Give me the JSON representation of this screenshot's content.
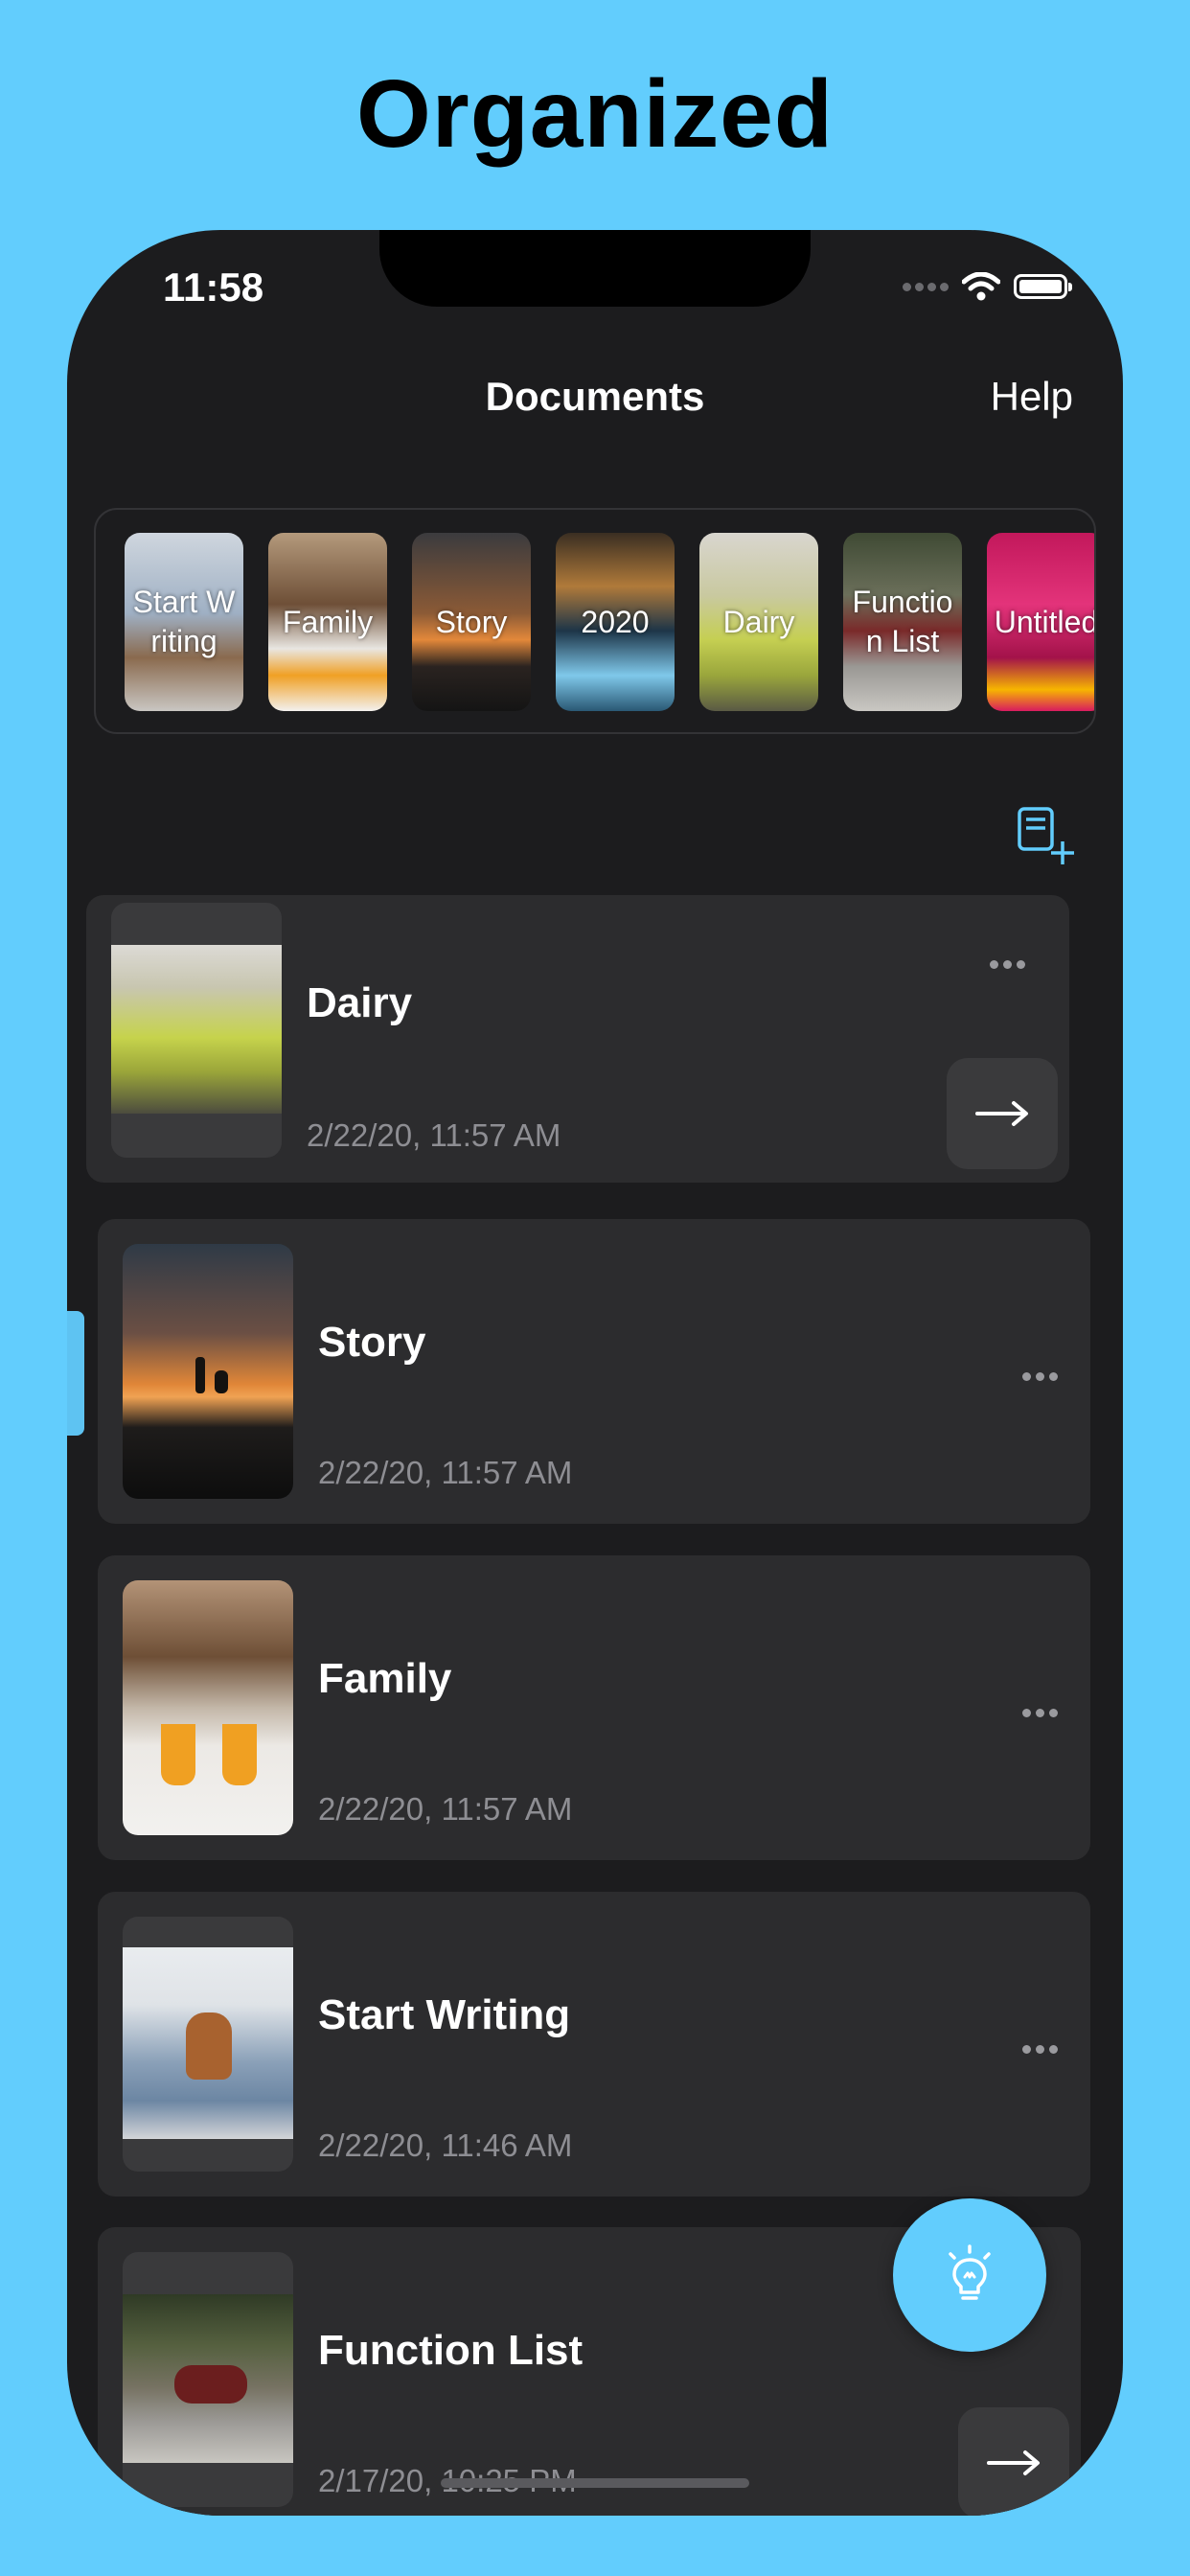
{
  "headline": "Organized",
  "status": {
    "time": "11:58"
  },
  "nav": {
    "title": "Documents",
    "help_label": "Help"
  },
  "strip": [
    {
      "label": "Start Writing"
    },
    {
      "label": "Family"
    },
    {
      "label": "Story"
    },
    {
      "label": "2020"
    },
    {
      "label": "Dairy"
    },
    {
      "label": "Function List"
    },
    {
      "label": "Untitled"
    }
  ],
  "documents": [
    {
      "title": "Dairy",
      "date": "2/22/20, 11:57 AM"
    },
    {
      "title": "Story",
      "date": "2/22/20, 11:57 AM"
    },
    {
      "title": "Family",
      "date": "2/22/20, 11:57 AM"
    },
    {
      "title": "Start Writing",
      "date": "2/22/20, 11:46 AM"
    },
    {
      "title": "Function List",
      "date": "2/17/20, 10:25 PM"
    }
  ],
  "colors": {
    "accent": "#62cdfd",
    "card": "#2c2c2e",
    "screen": "#1c1c1e"
  },
  "icons": {
    "new_document": "new-document-icon",
    "lightbulb": "lightbulb-icon",
    "arrow": "arrow-right-icon",
    "more": "ellipsis-icon"
  }
}
